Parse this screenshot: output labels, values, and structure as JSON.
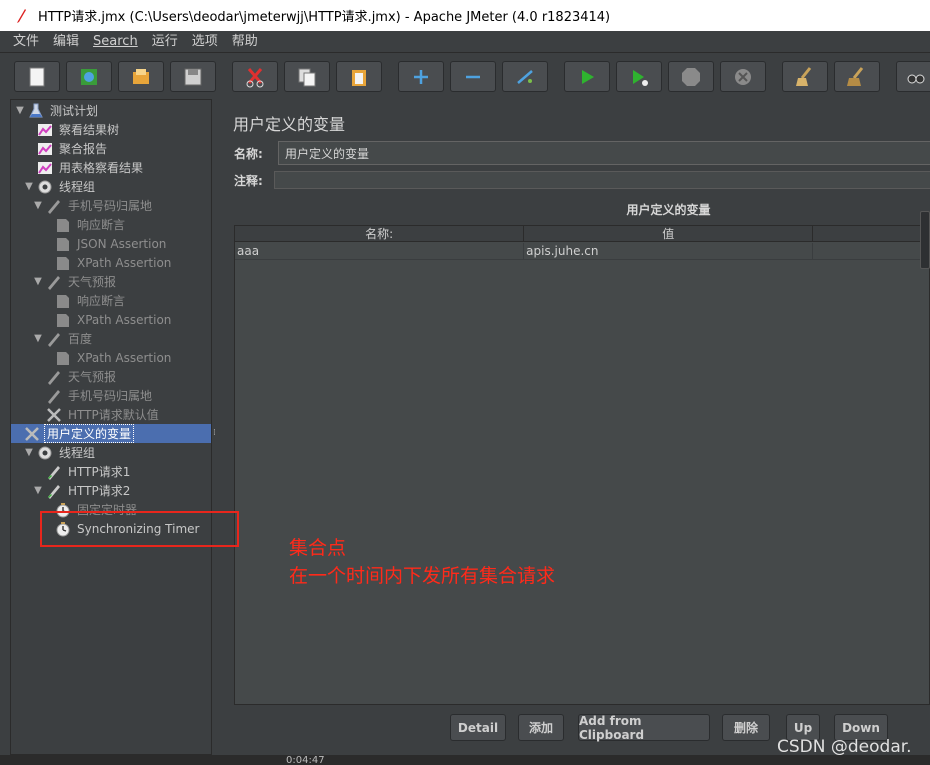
{
  "window": {
    "title": "HTTP请求.jmx (C:\\Users\\deodar\\jmeterwjj\\HTTP请求.jmx) - Apache JMeter (4.0 r1823414)"
  },
  "menu": [
    "文件",
    "编辑",
    "Search",
    "运行",
    "选项",
    "帮助"
  ],
  "toolbar": {
    "buttons": [
      {
        "name": "new-icon"
      },
      {
        "name": "templates-icon"
      },
      {
        "name": "open-icon"
      },
      {
        "name": "save-icon"
      },
      {
        "name": "cut-icon"
      },
      {
        "name": "copy-icon"
      },
      {
        "name": "paste-icon"
      },
      {
        "name": "expand-icon"
      },
      {
        "name": "collapse-icon"
      },
      {
        "name": "toggle-icon"
      },
      {
        "name": "start-icon"
      },
      {
        "name": "start-no-pause-icon"
      },
      {
        "name": "stop-icon"
      },
      {
        "name": "shutdown-icon"
      },
      {
        "name": "clear-icon"
      },
      {
        "name": "clear-all-icon"
      },
      {
        "name": "search-icon"
      }
    ]
  },
  "tree": [
    {
      "label": "测试计划",
      "icon": "flask",
      "indent": 0,
      "toggle": "▼",
      "dim": false
    },
    {
      "label": "察看结果树",
      "icon": "chart",
      "indent": 1,
      "toggle": "",
      "dim": false
    },
    {
      "label": "聚合报告",
      "icon": "chart",
      "indent": 1,
      "toggle": "",
      "dim": false
    },
    {
      "label": "用表格察看结果",
      "icon": "chart",
      "indent": 1,
      "toggle": "",
      "dim": false
    },
    {
      "label": "线程组",
      "icon": "gear",
      "indent": 1,
      "toggle": "▼",
      "dim": false
    },
    {
      "label": "手机号码归属地",
      "icon": "pen",
      "indent": 2,
      "toggle": "▼",
      "dim": true
    },
    {
      "label": "响应断言",
      "icon": "doc",
      "indent": 3,
      "toggle": "",
      "dim": true
    },
    {
      "label": "JSON Assertion",
      "icon": "doc",
      "indent": 3,
      "toggle": "",
      "dim": true
    },
    {
      "label": "XPath Assertion",
      "icon": "doc",
      "indent": 3,
      "toggle": "",
      "dim": true
    },
    {
      "label": "天气预报",
      "icon": "pen",
      "indent": 2,
      "toggle": "▼",
      "dim": true
    },
    {
      "label": "响应断言",
      "icon": "doc",
      "indent": 3,
      "toggle": "",
      "dim": true
    },
    {
      "label": "XPath Assertion",
      "icon": "doc",
      "indent": 3,
      "toggle": "",
      "dim": true
    },
    {
      "label": "百度",
      "icon": "pen",
      "indent": 2,
      "toggle": "▼",
      "dim": true
    },
    {
      "label": "XPath Assertion",
      "icon": "doc",
      "indent": 3,
      "toggle": "",
      "dim": true
    },
    {
      "label": "天气预报",
      "icon": "pen",
      "indent": 2,
      "toggle": "",
      "dim": true
    },
    {
      "label": "手机号码归属地",
      "icon": "pen",
      "indent": 2,
      "toggle": "",
      "dim": true
    },
    {
      "label": "HTTP请求默认值",
      "icon": "cross",
      "indent": 2,
      "toggle": "",
      "dim": true
    },
    {
      "label": "用户定义的变量",
      "icon": "cross",
      "indent": 2,
      "toggle": "",
      "dim": false,
      "selected": true
    },
    {
      "label": "线程组",
      "icon": "gear",
      "indent": 1,
      "toggle": "▼",
      "dim": false
    },
    {
      "label": "HTTP请求1",
      "icon": "pen-green",
      "indent": 2,
      "toggle": "",
      "dim": false
    },
    {
      "label": "HTTP请求2",
      "icon": "pen-green",
      "indent": 2,
      "toggle": "▼",
      "dim": false
    },
    {
      "label": "固定定时器",
      "icon": "clock",
      "indent": 3,
      "toggle": "",
      "dim": true
    },
    {
      "label": "Synchronizing Timer",
      "icon": "clock",
      "indent": 3,
      "toggle": "",
      "dim": false
    }
  ],
  "panel": {
    "title": "用户定义的变量",
    "name_label": "名称:",
    "name_value": "用户定义的变量",
    "comment_label": "注释:",
    "table_title": "用户定义的变量",
    "columns": [
      "名称:",
      "值",
      ""
    ],
    "rows": [
      [
        "aaa",
        "apis.juhe.cn",
        ""
      ]
    ]
  },
  "buttons": {
    "detail": "Detail",
    "add": "添加",
    "add_clipboard": "Add from Clipboard",
    "delete": "删除",
    "up": "Up",
    "down": "Down"
  },
  "annotation": {
    "line1": "集合点",
    "line2": "在一个时间内下发所有集合请求"
  },
  "watermark": "CSDN @deodar.",
  "clock": "0:04:47",
  "colors": {
    "background": "#3c3f41",
    "selection": "#4b6eaf",
    "annotation": "#ff2a1a"
  }
}
